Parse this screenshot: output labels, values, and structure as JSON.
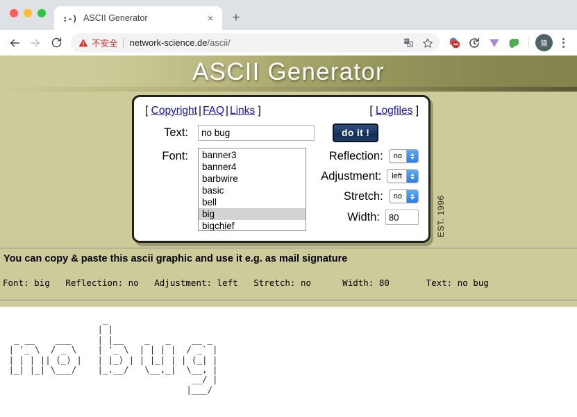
{
  "browser": {
    "tab": {
      "favicon": ":-)",
      "title": "ASCII Generator",
      "close_label": "×"
    },
    "new_tab_label": "+",
    "nav": {
      "back_title": "Back",
      "forward_title": "Forward",
      "reload_title": "Reload"
    },
    "omnibox": {
      "security_label": "不安全",
      "url_domain": "network-science.de",
      "url_path": "/ascii/"
    },
    "profile_initial": "猿",
    "colors": {
      "not_secure": "#d93025",
      "tabstrip": "#dee1e6",
      "omnibox_bg": "#f1f3f4"
    }
  },
  "page": {
    "title": "ASCII Generator",
    "est": "EST. 1996",
    "background": "#cccb99",
    "links": {
      "open_bracket": "[",
      "close_bracket": "]",
      "copyright": "Copyright",
      "faq": "FAQ",
      "links": "Links",
      "logfiles": "Logfiles",
      "separator": "|"
    },
    "form": {
      "text_label": "Text:",
      "text_value": "no bug",
      "text_placeholder": "",
      "submit_label": "do it !",
      "font_label": "Font:",
      "font_options": [
        "banner3",
        "banner4",
        "barbwire",
        "basic",
        "bell",
        "big",
        "bigchief"
      ],
      "font_selected": "big",
      "reflection_label": "Reflection:",
      "reflection_value": "no",
      "adjustment_label": "Adjustment:",
      "adjustment_value": "left",
      "stretch_label": "Stretch:",
      "stretch_value": "no",
      "width_label": "Width:",
      "width_value": "80"
    },
    "copy_hint": "You can copy & paste this ascii graphic and use it e.g. as mail signature",
    "status_line": "Font: big   Reflection: no   Adjustment: left   Stretch: no      Width: 80       Text: no bug",
    "status_fields": {
      "font": {
        "label": "Font:",
        "value": "big"
      },
      "reflection": {
        "label": "Reflection:",
        "value": "no"
      },
      "adjustment": {
        "label": "Adjustment:",
        "value": "left"
      },
      "stretch": {
        "label": "Stretch:",
        "value": "no"
      },
      "width": {
        "label": "Width:",
        "value": "80"
      },
      "text": {
        "label": "Text:",
        "value": "no bug"
      }
    },
    "ascii_art": "                   _                              \n                  | |                             \n  _ __    ___     | |__    _   _    __ _          \n | '_ \\  / _ \\    | '_ \\  | | | |  / _` |         \n | | | || (_) |   | |_) | | |_| | | (_| |         \n |_| |_| \\___/    |_.__/   \\__,_|  \\__, |         \n                                    __/ |         \n                                   |___/          "
  }
}
